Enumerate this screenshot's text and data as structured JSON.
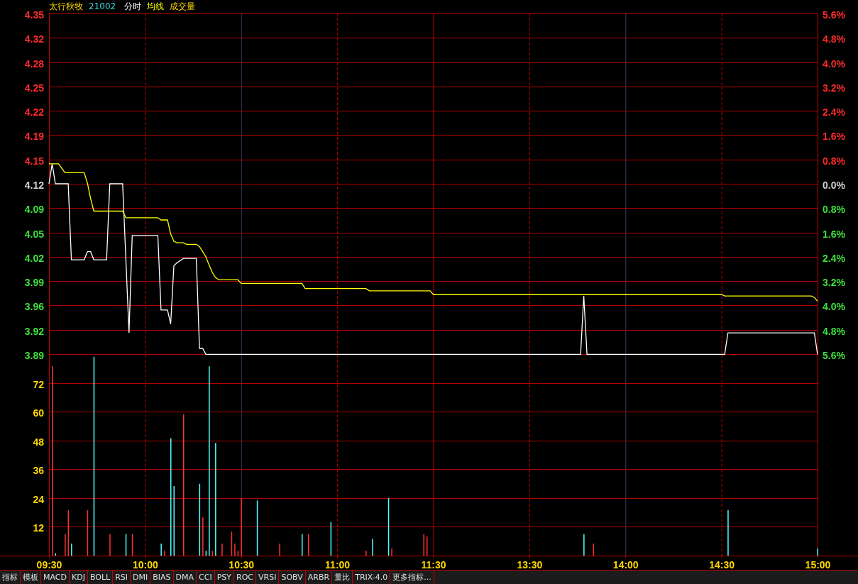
{
  "header": {
    "name": "太行秋牧",
    "code": "21002"
  },
  "price_panel": {
    "chart_data": {
      "type": "line",
      "categories": [
        null,
        null,
        null,
        null,
        null,
        null,
        null,
        null,
        null,
        null,
        null,
        null,
        null,
        null,
        null,
        null,
        null,
        null,
        null,
        null,
        null,
        null,
        null,
        null,
        null,
        null,
        null,
        null,
        null,
        null,
        null,
        null,
        null,
        null,
        null,
        null,
        null,
        null,
        null,
        null,
        null,
        null,
        null,
        null,
        null,
        null,
        null,
        null,
        null,
        null,
        null,
        null,
        null,
        null,
        null,
        null,
        null,
        null,
        null,
        null,
        null,
        null,
        null,
        null,
        null,
        null,
        null,
        null,
        null,
        null,
        null,
        null,
        null,
        null,
        null,
        null,
        null,
        null,
        null,
        null,
        null,
        null,
        null,
        null,
        null,
        null,
        null,
        null,
        null,
        null,
        null,
        null,
        null,
        null,
        null,
        null,
        null,
        null,
        null,
        null,
        null,
        null,
        null,
        null,
        null,
        null,
        null,
        null,
        null,
        null,
        null,
        null,
        null,
        null,
        null,
        null,
        null,
        null,
        null,
        null,
        null,
        null,
        null,
        null,
        null,
        null,
        null,
        null,
        null,
        null,
        null,
        null,
        null,
        null,
        null,
        null,
        null,
        null,
        null,
        null,
        null,
        null,
        null,
        null,
        null,
        null,
        null,
        null,
        null,
        null,
        null,
        null,
        null,
        null,
        null,
        null,
        null,
        null,
        null,
        null,
        null,
        null,
        null,
        null,
        null,
        null,
        null,
        null,
        null,
        null,
        null,
        null,
        null,
        null,
        null,
        null,
        null,
        null,
        null,
        null,
        null,
        null,
        null,
        null,
        null,
        null,
        null,
        null,
        null,
        null,
        null,
        null,
        null,
        null,
        null,
        null,
        null,
        null,
        null,
        null,
        null,
        null,
        null,
        null,
        null,
        null,
        null,
        null,
        null,
        null,
        null,
        null,
        null,
        null,
        null,
        null,
        null,
        null,
        null,
        null,
        null,
        null,
        null,
        null,
        null,
        null,
        null,
        null,
        null,
        null,
        null,
        null,
        null,
        null,
        null,
        null,
        null,
        null,
        null,
        null,
        null
      ],
      "series": [
        {
          "name": "分时",
          "color": "#ffffff",
          "values": [
            4.12,
            4.147,
            4.12,
            4.12,
            4.12,
            4.12,
            4.12,
            4.017,
            4.017,
            4.017,
            4.017,
            4.017,
            4.028,
            4.028,
            4.017,
            4.017,
            4.017,
            4.017,
            4.017,
            4.12,
            4.12,
            4.12,
            4.12,
            4.12,
            4.019,
            3.918,
            4.05,
            4.05,
            4.05,
            4.05,
            4.05,
            4.05,
            4.05,
            4.05,
            4.05,
            3.949,
            3.949,
            3.949,
            3.93,
            4.009,
            4.013,
            4.016,
            4.019,
            4.019,
            4.019,
            4.019,
            4.019,
            3.897,
            3.897,
            3.889,
            3.889,
            3.889,
            3.889,
            3.889,
            3.889,
            3.889,
            3.889,
            3.889,
            3.889,
            3.889,
            3.889,
            3.889,
            3.889,
            3.889,
            3.889,
            3.889,
            3.889,
            3.889,
            3.889,
            3.889,
            3.889,
            3.889,
            3.889,
            3.889,
            3.889,
            3.889,
            3.889,
            3.889,
            3.889,
            3.889,
            3.889,
            3.889,
            3.889,
            3.889,
            3.889,
            3.889,
            3.889,
            3.889,
            3.889,
            3.889,
            3.889,
            3.889,
            3.889,
            3.889,
            3.889,
            3.889,
            3.889,
            3.889,
            3.889,
            3.889,
            3.889,
            3.889,
            3.889,
            3.889,
            3.889,
            3.889,
            3.889,
            3.889,
            3.889,
            3.889,
            3.889,
            3.889,
            3.889,
            3.889,
            3.889,
            3.889,
            3.889,
            3.889,
            3.889,
            3.889,
            3.889,
            3.889,
            3.889,
            3.889,
            3.889,
            3.889,
            3.889,
            3.889,
            3.889,
            3.889,
            3.889,
            3.889,
            3.889,
            3.889,
            3.889,
            3.889,
            3.889,
            3.889,
            3.889,
            3.889,
            3.889,
            3.889,
            3.889,
            3.889,
            3.889,
            3.889,
            3.889,
            3.889,
            3.889,
            3.889,
            3.889,
            3.889,
            3.889,
            3.889,
            3.889,
            3.889,
            3.889,
            3.889,
            3.889,
            3.889,
            3.889,
            3.889,
            3.889,
            3.889,
            3.889,
            3.889,
            3.889,
            3.968,
            3.889,
            3.889,
            3.889,
            3.889,
            3.889,
            3.889,
            3.889,
            3.889,
            3.889,
            3.889,
            3.889,
            3.889,
            3.889,
            3.889,
            3.889,
            3.889,
            3.889,
            3.889,
            3.889,
            3.889,
            3.889,
            3.889,
            3.889,
            3.889,
            3.889,
            3.889,
            3.889,
            3.889,
            3.889,
            3.889,
            3.889,
            3.889,
            3.889,
            3.889,
            3.889,
            3.889,
            3.889,
            3.889,
            3.889,
            3.889,
            3.889,
            3.889,
            3.889,
            3.889,
            3.918,
            3.918,
            3.918,
            3.918,
            3.918,
            3.918,
            3.918,
            3.918,
            3.918,
            3.918,
            3.918,
            3.918,
            3.918,
            3.918,
            3.918,
            3.918,
            3.918,
            3.918,
            3.918,
            3.918,
            3.918,
            3.918,
            3.918,
            3.918,
            3.918,
            3.918,
            3.918,
            3.918,
            3.889
          ]
        },
        {
          "name": "均线",
          "color": "#ffff00",
          "values": [
            4.147,
            4.147,
            4.147,
            4.147,
            4.141,
            4.135,
            4.135,
            4.135,
            4.135,
            4.135,
            4.135,
            4.135,
            4.121,
            4.1,
            4.083,
            4.083,
            4.083,
            4.083,
            4.083,
            4.083,
            4.083,
            4.083,
            4.083,
            4.083,
            4.074,
            4.074,
            4.074,
            4.074,
            4.074,
            4.074,
            4.074,
            4.074,
            4.074,
            4.074,
            4.074,
            4.071,
            4.071,
            4.071,
            4.052,
            4.042,
            4.04,
            4.04,
            4.04,
            4.038,
            4.038,
            4.038,
            4.038,
            4.035,
            4.028,
            4.021,
            4.01,
            4.0,
            3.993,
            3.99,
            3.99,
            3.99,
            3.99,
            3.99,
            3.99,
            3.99,
            3.985,
            3.985,
            3.985,
            3.985,
            3.985,
            3.985,
            3.985,
            3.985,
            3.985,
            3.985,
            3.985,
            3.985,
            3.985,
            3.985,
            3.985,
            3.985,
            3.985,
            3.985,
            3.985,
            3.985,
            3.978,
            3.978,
            3.978,
            3.978,
            3.978,
            3.978,
            3.978,
            3.978,
            3.978,
            3.978,
            3.978,
            3.978,
            3.978,
            3.978,
            3.978,
            3.978,
            3.978,
            3.978,
            3.978,
            3.978,
            3.975,
            3.975,
            3.975,
            3.975,
            3.975,
            3.975,
            3.975,
            3.975,
            3.975,
            3.975,
            3.975,
            3.975,
            3.975,
            3.975,
            3.975,
            3.975,
            3.975,
            3.975,
            3.975,
            3.975,
            3.97,
            3.97,
            3.97,
            3.97,
            3.97,
            3.97,
            3.97,
            3.97,
            3.97,
            3.97,
            3.97,
            3.97,
            3.97,
            3.97,
            3.97,
            3.97,
            3.97,
            3.97,
            3.97,
            3.97,
            3.97,
            3.97,
            3.97,
            3.97,
            3.97,
            3.97,
            3.97,
            3.97,
            3.97,
            3.97,
            3.97,
            3.97,
            3.97,
            3.97,
            3.97,
            3.97,
            3.97,
            3.97,
            3.97,
            3.97,
            3.97,
            3.97,
            3.97,
            3.97,
            3.97,
            3.97,
            3.97,
            3.97,
            3.97,
            3.97,
            3.97,
            3.97,
            3.97,
            3.97,
            3.97,
            3.97,
            3.97,
            3.97,
            3.97,
            3.97,
            3.97,
            3.97,
            3.97,
            3.97,
            3.97,
            3.97,
            3.97,
            3.97,
            3.97,
            3.97,
            3.97,
            3.97,
            3.97,
            3.97,
            3.97,
            3.97,
            3.97,
            3.97,
            3.97,
            3.97,
            3.97,
            3.97,
            3.97,
            3.97,
            3.97,
            3.97,
            3.97,
            3.97,
            3.97,
            3.97,
            3.97,
            3.968,
            3.968,
            3.968,
            3.968,
            3.968,
            3.968,
            3.968,
            3.968,
            3.968,
            3.968,
            3.968,
            3.968,
            3.968,
            3.968,
            3.968,
            3.968,
            3.968,
            3.968,
            3.968,
            3.968,
            3.968,
            3.968,
            3.968,
            3.968,
            3.968,
            3.968,
            3.968,
            3.968,
            3.966,
            3.961
          ]
        }
      ],
      "ylim": [
        3.8883,
        4.3517
      ],
      "grid": true,
      "yticks": [
        {
          "value": 4.3507,
          "label": "4.35"
        },
        {
          "value": 4.3177,
          "label": "4.32"
        },
        {
          "value": 4.2848,
          "label": "4.28"
        },
        {
          "value": 4.2518,
          "label": "4.25"
        },
        {
          "value": 4.2189,
          "label": "4.22"
        },
        {
          "value": 4.1859,
          "label": "4.19"
        },
        {
          "value": 4.153,
          "label": "4.15"
        },
        {
          "value": 4.12,
          "label": "4.12"
        },
        {
          "value": 4.087,
          "label": "4.09"
        },
        {
          "value": 4.0541,
          "label": "4.05"
        },
        {
          "value": 4.0211,
          "label": "4.02"
        },
        {
          "value": 3.9882,
          "label": "3.99"
        },
        {
          "value": 3.9552,
          "label": "3.96"
        },
        {
          "value": 3.9223,
          "label": "3.92"
        },
        {
          "value": 3.8893,
          "label": "3.89"
        }
      ]
    },
    "right_axis": [
      "5.6%",
      "4.8%",
      "4.0%",
      "3.2%",
      "2.4%",
      "1.6%",
      "0.8%",
      "0.0%",
      "0.8%",
      "1.6%",
      "2.4%",
      "3.2%",
      "4.0%",
      "4.8%",
      "5.6%"
    ]
  },
  "volume_panel": {
    "chart_data": {
      "type": "bar",
      "title": "成交量",
      "categories": [
        "09:30",
        null,
        null,
        null,
        null,
        null,
        null,
        null,
        null,
        null,
        null,
        null,
        null,
        null,
        null,
        null,
        null,
        null,
        null,
        null,
        null,
        null,
        null,
        null,
        null,
        null,
        null,
        null,
        null,
        null,
        "10:00",
        null,
        null,
        null,
        null,
        null,
        null,
        null,
        null,
        null,
        null,
        null,
        null,
        null,
        null,
        null,
        null,
        null,
        null,
        null,
        null,
        null,
        null,
        null,
        null,
        null,
        null,
        null,
        null,
        null,
        "10:30",
        null,
        null,
        null,
        null,
        null,
        null,
        null,
        null,
        null,
        null,
        null,
        null,
        null,
        null,
        null,
        null,
        null,
        null,
        null,
        null,
        null,
        null,
        null,
        null,
        null,
        null,
        null,
        null,
        null,
        "11:00",
        null,
        null,
        null,
        null,
        null,
        null,
        null,
        null,
        null,
        null,
        null,
        null,
        null,
        null,
        null,
        null,
        null,
        null,
        null,
        null,
        null,
        null,
        null,
        null,
        null,
        null,
        null,
        null,
        null,
        "11:30",
        null,
        null,
        null,
        null,
        null,
        null,
        null,
        null,
        null,
        null,
        null,
        null,
        null,
        null,
        null,
        null,
        null,
        null,
        null,
        null,
        null,
        null,
        null,
        null,
        null,
        null,
        null,
        null,
        null,
        "13:30",
        null,
        null,
        null,
        null,
        null,
        null,
        null,
        null,
        null,
        null,
        null,
        null,
        null,
        null,
        null,
        null,
        null,
        null,
        null,
        null,
        null,
        null,
        null,
        null,
        null,
        null,
        null,
        null,
        null,
        "14:00",
        null,
        null,
        null,
        null,
        null,
        null,
        null,
        null,
        null,
        null,
        null,
        null,
        null,
        null,
        null,
        null,
        null,
        null,
        null,
        null,
        null,
        null,
        null,
        null,
        null,
        null,
        null,
        null,
        null,
        "14:30",
        null,
        null,
        null,
        null,
        null,
        null,
        null,
        null,
        null,
        null,
        null,
        null,
        null,
        null,
        null,
        null,
        null,
        null,
        null,
        null,
        null,
        null,
        null,
        null,
        null,
        null,
        null,
        null,
        null,
        "15:00"
      ],
      "series": [
        {
          "color": "#ff3232",
          "values": [
            null,
            79,
            null,
            null,
            null,
            9,
            19,
            null,
            null,
            null,
            null,
            null,
            19,
            null,
            null,
            null,
            null,
            null,
            null,
            9,
            null,
            null,
            null,
            null,
            null,
            null,
            9,
            null,
            null,
            null,
            null,
            null,
            null,
            null,
            null,
            null,
            2,
            null,
            null,
            null,
            null,
            null,
            59,
            null,
            null,
            null,
            null,
            null,
            16,
            null,
            null,
            2,
            null,
            null,
            5,
            null,
            null,
            10,
            5,
            2,
            24,
            null,
            null,
            null,
            null,
            null,
            null,
            null,
            null,
            null,
            null,
            null,
            5,
            null,
            null,
            null,
            null,
            null,
            null,
            null,
            null,
            9,
            null,
            null,
            null,
            null,
            null,
            null,
            null,
            null,
            null,
            null,
            null,
            null,
            null,
            null,
            null,
            null,
            null,
            2,
            null,
            null,
            null,
            null,
            null,
            null,
            null,
            3,
            null,
            null,
            null,
            null,
            null,
            null,
            null,
            null,
            null,
            9,
            8,
            null,
            null,
            null,
            null,
            null,
            null,
            null,
            null,
            null,
            null,
            null,
            null,
            null,
            null,
            null,
            null,
            null,
            null,
            null,
            null,
            null,
            null,
            null,
            null,
            null,
            null,
            null,
            null,
            null,
            null,
            null,
            null,
            null,
            null,
            null,
            null,
            null,
            null,
            null,
            null,
            null,
            null,
            null,
            null,
            null,
            null,
            null,
            null,
            null,
            null,
            null,
            5,
            null,
            null,
            null,
            null,
            null,
            null,
            null,
            null,
            null,
            null,
            null,
            null,
            null,
            null,
            null,
            null,
            null,
            null,
            null,
            null,
            null,
            null,
            null,
            null,
            null,
            null,
            null,
            null,
            null,
            null,
            null,
            null,
            null,
            null,
            null,
            null,
            null,
            null,
            null,
            null,
            null,
            null,
            null,
            null,
            null,
            null,
            null,
            null,
            null,
            null,
            null,
            null,
            null,
            null,
            null,
            null,
            null,
            null,
            null,
            null,
            null,
            null,
            null,
            null,
            null,
            null,
            null,
            null,
            null,
            null
          ]
        },
        {
          "color": "#54ffff",
          "values": [
            null,
            null,
            1,
            null,
            null,
            null,
            null,
            5,
            null,
            null,
            null,
            null,
            null,
            null,
            83,
            null,
            null,
            null,
            null,
            null,
            null,
            null,
            null,
            null,
            9,
            null,
            null,
            null,
            null,
            null,
            null,
            null,
            null,
            null,
            null,
            5,
            null,
            null,
            49,
            29,
            null,
            null,
            null,
            null,
            null,
            null,
            null,
            30,
            null,
            2,
            79,
            null,
            47,
            null,
            null,
            null,
            null,
            null,
            null,
            null,
            null,
            null,
            null,
            null,
            null,
            23,
            null,
            null,
            null,
            null,
            null,
            null,
            null,
            null,
            null,
            null,
            null,
            null,
            null,
            9,
            null,
            null,
            null,
            null,
            null,
            null,
            null,
            null,
            14,
            null,
            null,
            null,
            null,
            null,
            null,
            null,
            null,
            null,
            null,
            null,
            null,
            7,
            null,
            null,
            null,
            null,
            24,
            null,
            null,
            null,
            null,
            null,
            null,
            null,
            null,
            null,
            null,
            null,
            null,
            null,
            null,
            null,
            null,
            null,
            null,
            null,
            null,
            null,
            null,
            null,
            null,
            null,
            null,
            null,
            null,
            null,
            null,
            null,
            null,
            null,
            null,
            null,
            null,
            null,
            null,
            null,
            null,
            null,
            null,
            null,
            null,
            null,
            null,
            null,
            null,
            null,
            null,
            null,
            null,
            null,
            null,
            null,
            null,
            null,
            null,
            null,
            null,
            9,
            null,
            null,
            null,
            null,
            null,
            null,
            null,
            null,
            null,
            null,
            null,
            null,
            null,
            null,
            null,
            null,
            null,
            null,
            null,
            null,
            null,
            null,
            null,
            null,
            null,
            null,
            null,
            null,
            null,
            null,
            null,
            null,
            null,
            null,
            null,
            null,
            null,
            null,
            null,
            null,
            null,
            null,
            null,
            null,
            19,
            null,
            null,
            null,
            null,
            null,
            null,
            null,
            null,
            null,
            null,
            null,
            null,
            null,
            null,
            null,
            null,
            null,
            null,
            null,
            null,
            null,
            null,
            null,
            null,
            null,
            null,
            null,
            3
          ]
        }
      ],
      "ylim": [
        0,
        83.8
      ],
      "grid": true,
      "yticks": [
        12,
        24,
        36,
        48,
        60,
        72
      ]
    }
  },
  "tabs": [
    {
      "label": "指标",
      "selected": false
    },
    {
      "label": "模板",
      "selected": false
    },
    {
      "label": "MACD",
      "selected": false
    },
    {
      "label": "KDJ",
      "selected": false
    },
    {
      "label": "BOLL",
      "selected": false
    },
    {
      "label": "RSI",
      "selected": false
    },
    {
      "label": "DMI",
      "selected": false
    },
    {
      "label": "BIAS",
      "selected": false
    },
    {
      "label": "DMA",
      "selected": false
    },
    {
      "label": "CCI",
      "selected": false
    },
    {
      "label": "PSY",
      "selected": false
    },
    {
      "label": "ROC",
      "selected": false
    },
    {
      "label": "VRSI",
      "selected": false
    },
    {
      "label": "SOBV",
      "selected": false
    },
    {
      "label": "ARBR",
      "selected": false
    },
    {
      "label": "量比",
      "selected": false
    },
    {
      "label": "TRIX-4.0",
      "selected": false
    },
    {
      "label": "更多指标...",
      "selected": false
    }
  ]
}
